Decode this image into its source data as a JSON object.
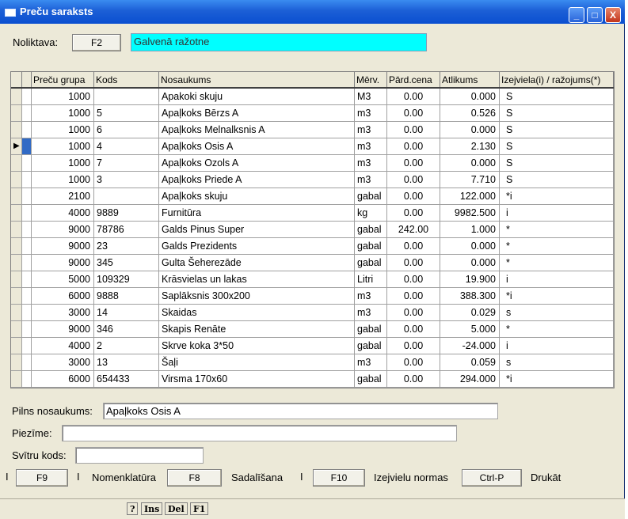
{
  "window": {
    "title": "Preču saraksts",
    "controls": {
      "minimize": "_",
      "maximize": "□",
      "close": "X"
    }
  },
  "warehouse": {
    "label": "Noliktava:",
    "key_button": "F2",
    "value": "Galvenā ražotne"
  },
  "grid": {
    "columns": [
      "Preču grupa",
      "Kods",
      "Nosaukums",
      "Mērv.",
      "Pārd.cena",
      "Atlikums",
      "Izejviela(i) / ražojums(*)"
    ],
    "current_row_marker": "▶",
    "rows": [
      {
        "group": "1000",
        "code": "",
        "name": "Apakoki skuju",
        "unit": "M3",
        "price": "0.00",
        "stock": "0.000",
        "type": "S"
      },
      {
        "group": "1000",
        "code": "5",
        "name": "Apaļkoks Bērzs A",
        "unit": "m3",
        "price": "0.00",
        "stock": "0.526",
        "type": "S"
      },
      {
        "group": "1000",
        "code": "6",
        "name": "Apaļkoks Melnalksnis A",
        "unit": "m3",
        "price": "0.00",
        "stock": "0.000",
        "type": "S"
      },
      {
        "group": "1000",
        "code": "4",
        "name": "Apaļkoks Osis A",
        "unit": "m3",
        "price": "0.00",
        "stock": "2.130",
        "type": "S"
      },
      {
        "group": "1000",
        "code": "7",
        "name": "Apaļkoks Ozols A",
        "unit": "m3",
        "price": "0.00",
        "stock": "0.000",
        "type": "S"
      },
      {
        "group": "1000",
        "code": "3",
        "name": "Apaļkoks Priede A",
        "unit": "m3",
        "price": "0.00",
        "stock": "7.710",
        "type": "S"
      },
      {
        "group": "2100",
        "code": "",
        "name": "Apaļkoks skuju",
        "unit": "gabal",
        "price": "0.00",
        "stock": "122.000",
        "type": "*i"
      },
      {
        "group": "4000",
        "code": "9889",
        "name": "Furnitūra",
        "unit": "kg",
        "price": "0.00",
        "stock": "9982.500",
        "type": "i"
      },
      {
        "group": "9000",
        "code": "78786",
        "name": "Galds Pinus Super",
        "unit": "gabal",
        "price": "242.00",
        "stock": "1.000",
        "type": "*"
      },
      {
        "group": "9000",
        "code": "23",
        "name": "Galds Prezidents",
        "unit": "gabal",
        "price": "0.00",
        "stock": "0.000",
        "type": "*"
      },
      {
        "group": "9000",
        "code": "345",
        "name": "Gulta Šeherezāde",
        "unit": "gabal",
        "price": "0.00",
        "stock": "0.000",
        "type": "*"
      },
      {
        "group": "5000",
        "code": "109329",
        "name": "Krāsvielas un lakas",
        "unit": "Litri",
        "price": "0.00",
        "stock": "19.900",
        "type": "i"
      },
      {
        "group": "6000",
        "code": "9888",
        "name": "Saplāksnis 300x200",
        "unit": "m3",
        "price": "0.00",
        "stock": "388.300",
        "type": "*i"
      },
      {
        "group": "3000",
        "code": "14",
        "name": "Skaidas",
        "unit": "m3",
        "price": "0.00",
        "stock": "0.029",
        "type": "s"
      },
      {
        "group": "9000",
        "code": "346",
        "name": "Skapis Renāte",
        "unit": "gabal",
        "price": "0.00",
        "stock": "5.000",
        "type": "*"
      },
      {
        "group": "4000",
        "code": "2",
        "name": "Skrve koka 3*50",
        "unit": "gabal",
        "price": "0.00",
        "stock": "-24.000",
        "type": "i"
      },
      {
        "group": "3000",
        "code": "13",
        "name": "Šaļi",
        "unit": "m3",
        "price": "0.00",
        "stock": "0.059",
        "type": "s"
      },
      {
        "group": "6000",
        "code": "654433",
        "name": "Virsma 170x60",
        "unit": "gabal",
        "price": "0.00",
        "stock": "294.000",
        "type": "*i"
      }
    ],
    "selected_index": 3
  },
  "details": {
    "full_name_label": "Pilns nosaukums:",
    "full_name_value": "Apaļkoks Osis A",
    "note_label": "Piezīme:",
    "note_value": "",
    "barcode_label": "Svītru kods:",
    "barcode_value": ""
  },
  "actions": {
    "separator": "I",
    "f9": "F9",
    "nomenclature_label": "Nomenklatūra",
    "f8": "F8",
    "split_label": "Sadalīšana",
    "f10": "F10",
    "norms_label": "Izejvielu normas",
    "ctrlp": "Ctrl-P",
    "print_label": "Drukāt"
  },
  "statusbar": {
    "keys": [
      "?",
      "Ins",
      "Del",
      "F1"
    ]
  },
  "colors": {
    "title": "#1c5fd6",
    "warehouse_field": "#00ffff",
    "selection": "#316ac5"
  }
}
